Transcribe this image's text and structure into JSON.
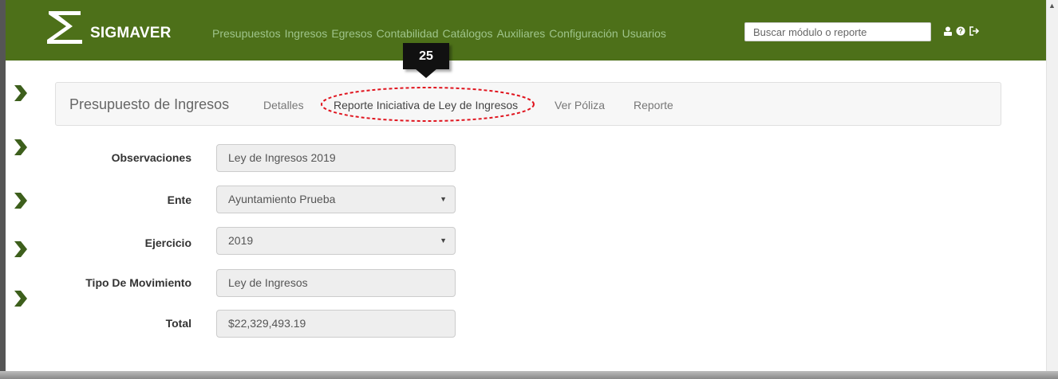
{
  "navbar": {
    "brand": "SIGMAVER",
    "menu": [
      "Presupuestos",
      "Ingresos",
      "Egresos",
      "Contabilidad",
      "Catálogos",
      "Auxiliares",
      "Configuración",
      "Usuarios"
    ],
    "search_placeholder": "Buscar módulo o reporte",
    "icons": [
      "user-icon",
      "help-icon",
      "logout-icon"
    ],
    "background": "#4d7019"
  },
  "callout": {
    "number": "25"
  },
  "panel": {
    "title": "Presupuesto de Ingresos",
    "tabs": [
      "Detalles",
      "Reporte Iniciativa de Ley de Ingresos",
      "Ver Póliza",
      "Reporte"
    ],
    "highlighted_tab": "Reporte Iniciativa de Ley de Ingresos"
  },
  "form": {
    "observaciones": {
      "label": "Observaciones",
      "value": "Ley de Ingresos 2019"
    },
    "ente": {
      "label": "Ente",
      "value": "Ayuntamiento Prueba"
    },
    "ejercicio": {
      "label": "Ejercicio",
      "value": "2019"
    },
    "tipo_movimiento": {
      "label": "Tipo De Movimiento",
      "value": "Ley de Ingresos"
    },
    "total": {
      "label": "Total",
      "value": "$22,329,493.19"
    }
  },
  "side_arrow_color": "#3d5f1c"
}
